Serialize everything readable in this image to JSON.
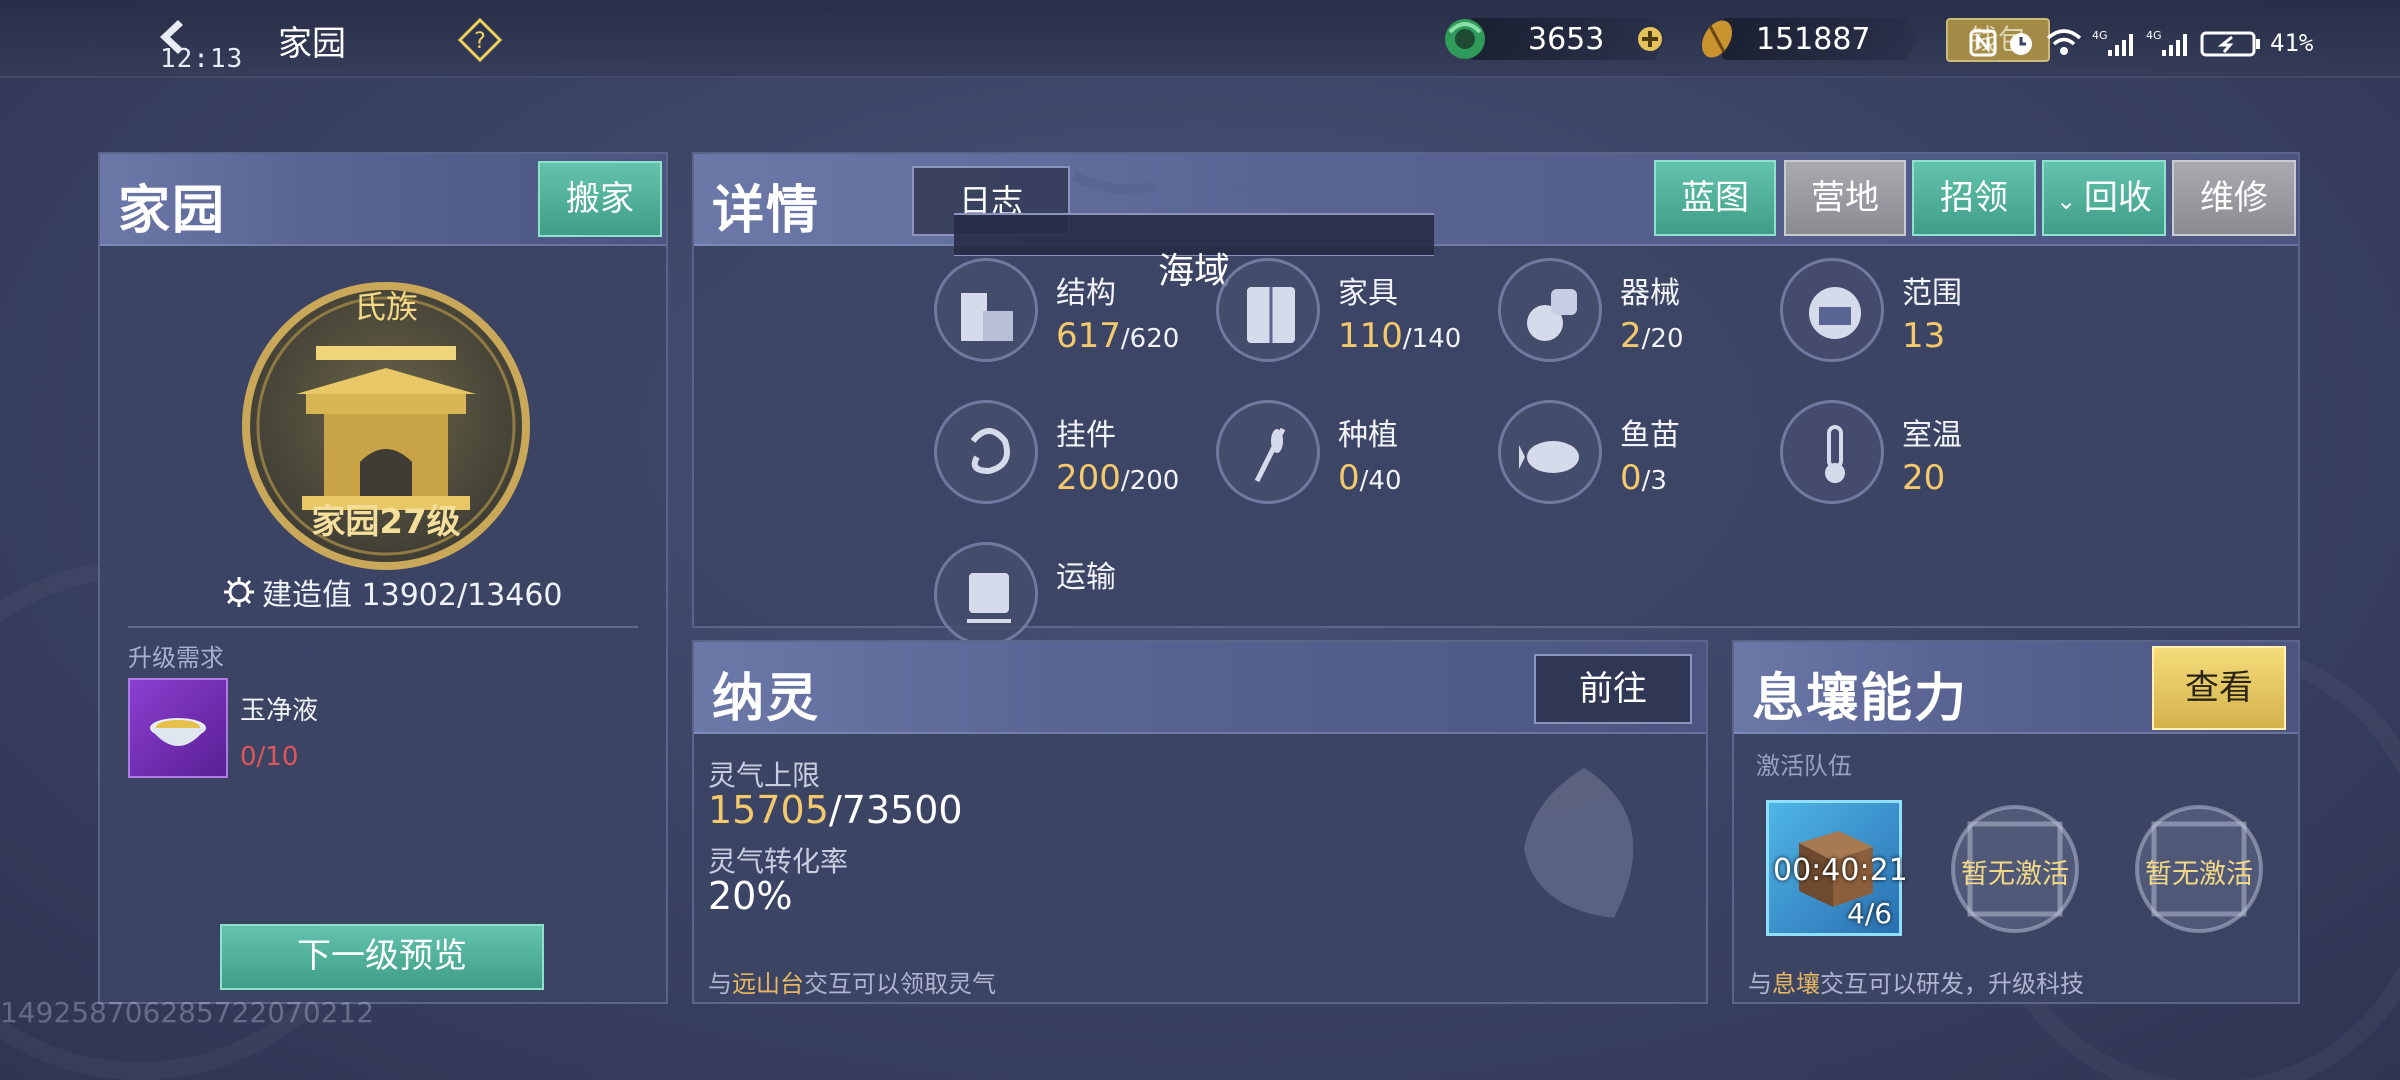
{
  "topbar": {
    "clock": "12:13",
    "title": "家园",
    "jade_value": "3653",
    "grain_value": "151887",
    "wallet_label": "钱包",
    "battery": "41%"
  },
  "homeland": {
    "title": "家园",
    "move_button": "搬家",
    "clan_label": "氏族",
    "level_label": "家园27级",
    "build_label": "建造值 13902/13460",
    "upgrade_req_title": "升级需求",
    "item_name": "玉净液",
    "item_count": "0/10",
    "preview_button": "下一级预览"
  },
  "details": {
    "title": "详情",
    "log_button": "日志",
    "sea_label": "海域",
    "buttons": [
      "蓝图",
      "营地",
      "招领",
      "回收",
      "维修"
    ],
    "stats": [
      {
        "name": "结构",
        "value": "617",
        "max": "/620",
        "icon": "buildings-icon"
      },
      {
        "name": "家具",
        "value": "110",
        "max": "/140",
        "icon": "cabinet-icon"
      },
      {
        "name": "器械",
        "value": "2",
        "max": "/20",
        "icon": "device-icon"
      },
      {
        "name": "范围",
        "value": "13",
        "max": "",
        "icon": "range-icon"
      },
      {
        "name": "挂件",
        "value": "200",
        "max": "/200",
        "icon": "pendant-icon"
      },
      {
        "name": "种植",
        "value": "0",
        "max": "/40",
        "icon": "wheat-icon"
      },
      {
        "name": "鱼苗",
        "value": "0",
        "max": "/3",
        "icon": "fish-icon"
      },
      {
        "name": "室温",
        "value": "20",
        "max": "",
        "icon": "thermometer-icon"
      },
      {
        "name": "运输",
        "value": "",
        "max": "",
        "icon": "cart-icon"
      }
    ]
  },
  "nalin": {
    "title": "纳灵",
    "go_button": "前往",
    "cap_label": "灵气上限",
    "cap_current": "15705",
    "cap_max": "/73500",
    "rate_label": "灵气转化率",
    "rate_value": "20%",
    "hint_prefix": "与",
    "hint_place": "远山台",
    "hint_suffix": "交互可以领取灵气"
  },
  "xirang": {
    "title": "息壤能力",
    "view_button": "查看",
    "team_label": "激活队伍",
    "slot_timer": "00:40:21",
    "slot_count": "4/6",
    "empty_label_1": "暂无激活",
    "empty_label_2": "暂无激活",
    "hint_prefix": "与",
    "hint_place": "息壤",
    "hint_suffix": "交互可以研发，升级科技"
  },
  "footer_id": "1492587062857220702​12"
}
